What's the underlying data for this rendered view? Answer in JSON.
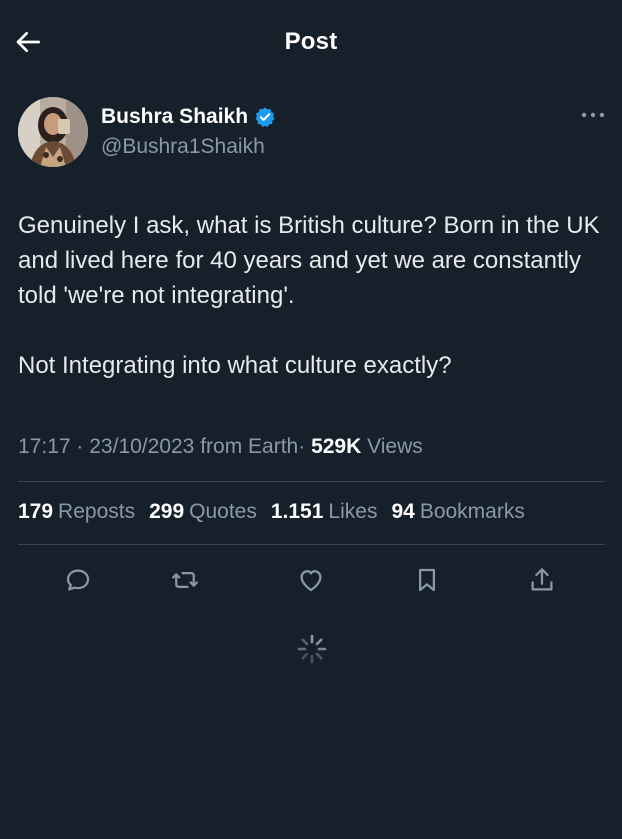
{
  "header": {
    "title": "Post",
    "back_icon": "arrow-left-icon"
  },
  "author": {
    "name": "Bushra Shaikh",
    "handle": "@Bushra1Shaikh",
    "verified": true,
    "verified_color": "#1d9bf0"
  },
  "post": {
    "paragraphs": [
      "Genuinely I ask, what is British culture? Born in the UK and lived here for 40 years and yet we are constantly told 'we're not integrating'.",
      "Not Integrating into what culture exactly?"
    ]
  },
  "meta": {
    "time": "17:17",
    "date": "23/10/2023",
    "source": "from Earth",
    "separator": "·",
    "views_count": "529K",
    "views_label": "Views"
  },
  "stats": {
    "reposts": {
      "count": "179",
      "label": "Reposts"
    },
    "quotes": {
      "count": "299",
      "label": "Quotes"
    },
    "likes": {
      "count": "1.151",
      "label": "Likes"
    },
    "bookmarks": {
      "count": "94",
      "label": "Bookmarks"
    }
  },
  "actions": [
    {
      "name": "reply",
      "icon": "reply-icon"
    },
    {
      "name": "repost",
      "icon": "repost-icon"
    },
    {
      "name": "like",
      "icon": "heart-icon"
    },
    {
      "name": "bookmark",
      "icon": "bookmark-icon"
    },
    {
      "name": "share",
      "icon": "share-icon"
    }
  ],
  "colors": {
    "background": "#15202b",
    "primary_text": "#e7e9ea",
    "secondary_text": "#8b98a5",
    "divider": "#38444d",
    "icon": "#8b98a5"
  }
}
